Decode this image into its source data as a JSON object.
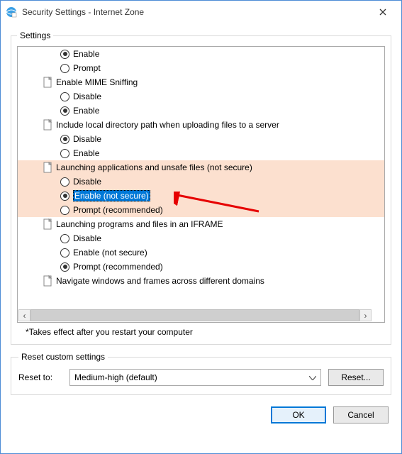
{
  "window": {
    "title": "Security Settings - Internet Zone"
  },
  "settings_group_label": "Settings",
  "items": {
    "g0_opt_enable": "Enable",
    "g0_opt_prompt": "Prompt",
    "g1_title": "Enable MIME Sniffing",
    "g1_disable": "Disable",
    "g1_enable": "Enable",
    "g2_title": "Include local directory path when uploading files to a server",
    "g2_disable": "Disable",
    "g2_enable": "Enable",
    "g3_title": "Launching applications and unsafe files (not secure)",
    "g3_disable": "Disable",
    "g3_enable": "Enable (not secure)",
    "g3_prompt": "Prompt (recommended)",
    "g4_title": "Launching programs and files in an IFRAME",
    "g4_disable": "Disable",
    "g4_enable": "Enable (not secure)",
    "g4_prompt": "Prompt (recommended)",
    "g5_title": "Navigate windows and frames across different domains"
  },
  "footnote": "*Takes effect after you restart your computer",
  "reset_group_label": "Reset custom settings",
  "reset_to_label": "Reset to:",
  "reset_level": "Medium-high (default)",
  "reset_button": "Reset...",
  "ok_label": "OK",
  "cancel_label": "Cancel"
}
